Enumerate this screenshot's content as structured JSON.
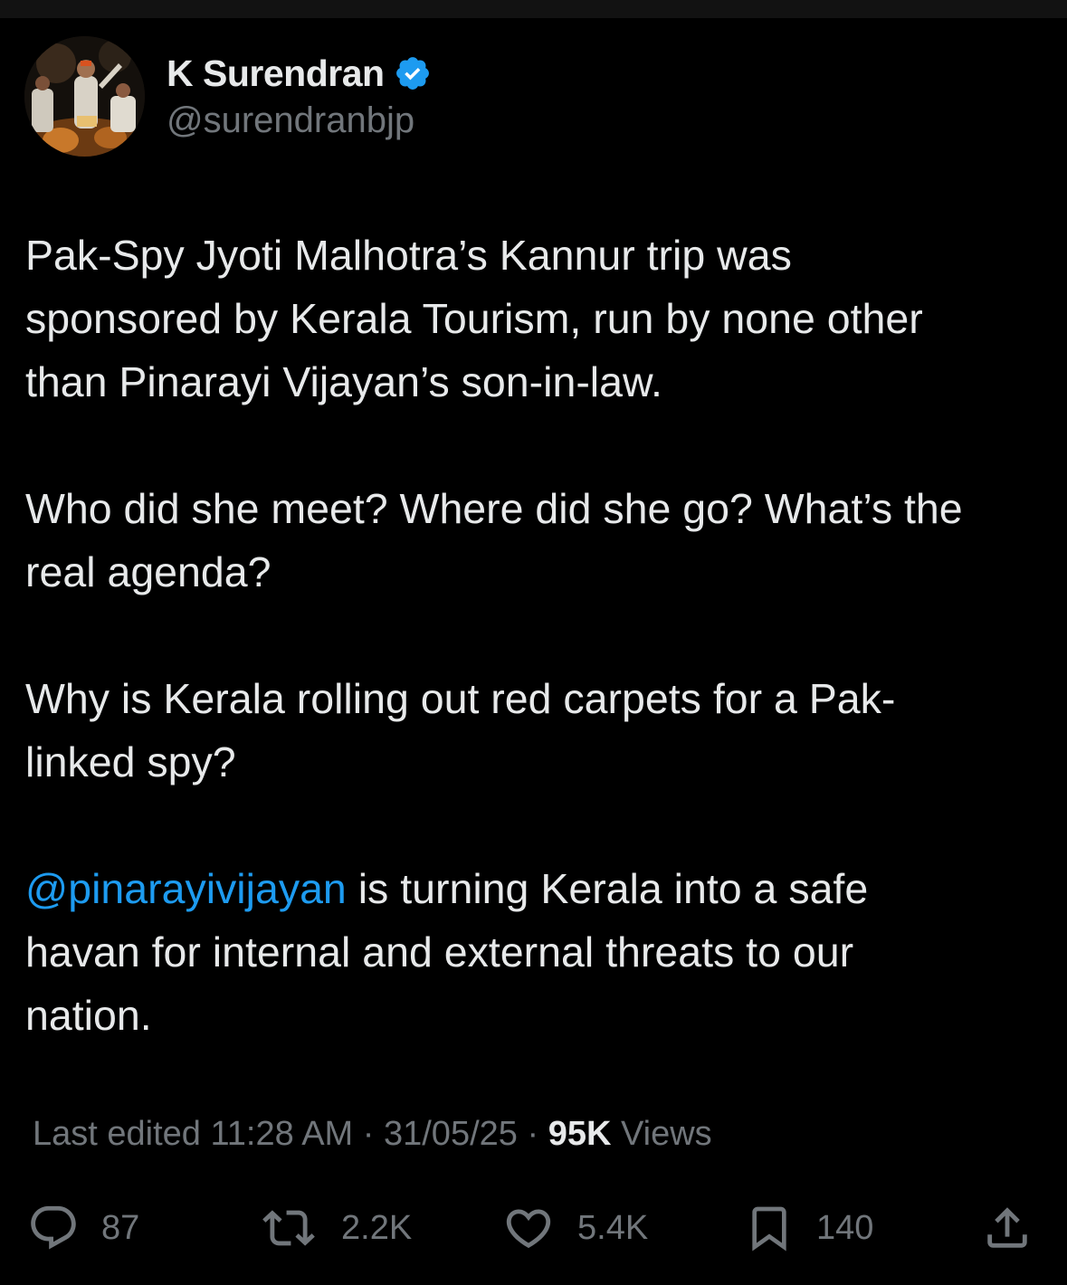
{
  "tweet": {
    "author": {
      "display_name": "K Surendran",
      "handle": "@surendranbjp",
      "verified": true
    },
    "body": {
      "p1": "Pak-Spy  Jyoti Malhotra’s Kannur trip was\nsponsored by Kerala Tourism, run by none other\nthan Pinarayi Vijayan’s son-in-law.",
      "p2": "Who did she meet? Where did she go? What’s the\nreal agenda?",
      "p3": "Why is Kerala rolling out red carpets for a Pak-\nlinked spy?",
      "p4_mention": "@pinarayivijayan",
      "p4_rest": " is turning Kerala into a safe\nhavan for internal and external threats to our\nnation."
    },
    "meta": {
      "edited_label": "Last edited 11:28 AM · 31/05/25 ",
      "separator": "· ",
      "views_count": "95K",
      "views_label": " Views"
    },
    "actions": {
      "replies": "87",
      "reposts": "2.2K",
      "likes": "5.4K",
      "bookmarks": "140"
    },
    "icons": {
      "reply": "reply-icon",
      "repost": "repost-icon",
      "like": "like-icon",
      "bookmark": "bookmark-icon",
      "share": "share-icon",
      "verified": "verified-badge-icon"
    },
    "colors": {
      "background": "#000000",
      "text": "#e7e9ea",
      "secondary": "#71767b",
      "accent": "#1d9bf0"
    }
  }
}
